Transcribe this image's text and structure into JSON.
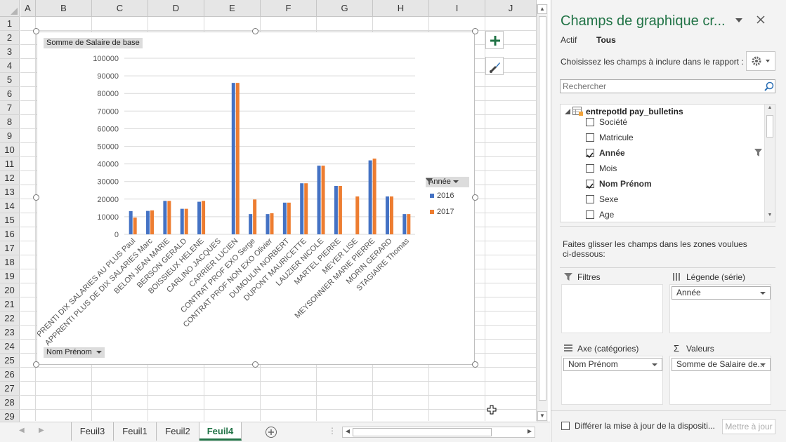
{
  "sheet": {
    "columns": [
      "A",
      "B",
      "C",
      "D",
      "E",
      "F",
      "G",
      "H",
      "I",
      "J"
    ],
    "rows": [
      "1",
      "2",
      "3",
      "4",
      "5",
      "6",
      "7",
      "8",
      "9",
      "10",
      "11",
      "12",
      "13",
      "14",
      "15",
      "16",
      "17",
      "18",
      "19",
      "20",
      "21",
      "22",
      "23",
      "24",
      "25",
      "26",
      "27",
      "28",
      "29"
    ],
    "tabs": [
      "Feuil3",
      "Feuil1",
      "Feuil2",
      "Feuil4"
    ],
    "active_tab": "Feuil4"
  },
  "chart": {
    "values_button": "Somme  de Salaire de base",
    "axis_button": "Nom Prénom",
    "legend_button": "Année",
    "colors": {
      "2016": "#4472c4",
      "2017": "#ed7d31"
    }
  },
  "chart_data": {
    "type": "bar",
    "title": "",
    "xlabel": "",
    "ylabel": "",
    "ylim": [
      0,
      100000
    ],
    "yticks": [
      0,
      10000,
      20000,
      30000,
      40000,
      50000,
      60000,
      70000,
      80000,
      90000,
      100000
    ],
    "grid": true,
    "legend_position": "right",
    "categories": [
      "APPRENTI DIX SALARIES AU PLUS Paul",
      "APPRENTI PLUS DE DIX SALARIES Marc",
      "BELON JEAN MARIE",
      "BERSON GERALD",
      "BOISSIEUX HELENE",
      "CARLINO JACQUES",
      "CARRIER LUCIEN",
      "CONTRAT PROF EXO Serge",
      "CONTRAT PROF NON EXO Olivier",
      "DUMOULIN NORBERT",
      "DUPONT MAURICETTE",
      "LAUZIER NICOLE",
      "MARTEL PIERRE",
      "MEYER LISE",
      "MEYSONNIER MARIE PIERRE",
      "MORIN GERARD",
      "STAGIAIRE Thomas"
    ],
    "series": [
      {
        "name": "2016",
        "values": [
          13200,
          13300,
          19000,
          14500,
          18500,
          0,
          86000,
          11500,
          11500,
          18000,
          29000,
          39000,
          27500,
          0,
          42000,
          21500,
          11500
        ]
      },
      {
        "name": "2017",
        "values": [
          9500,
          13600,
          19000,
          14500,
          19000,
          0,
          86000,
          19800,
          12000,
          18000,
          29000,
          39000,
          27500,
          21500,
          43000,
          21500,
          11500
        ]
      }
    ]
  },
  "pane": {
    "title": "Champs de graphique cr...",
    "tab_active": "Actif",
    "tab_all": "Tous",
    "choose_label": "Choisissez les champs à inclure dans le rapport :",
    "search_placeholder": "Rechercher",
    "table_name": "entrepotId pay_bulletins",
    "fields": [
      {
        "label": "Société",
        "checked": false
      },
      {
        "label": "Matricule",
        "checked": false
      },
      {
        "label": "Année",
        "checked": true
      },
      {
        "label": "Mois",
        "checked": false
      },
      {
        "label": "Nom Prénom",
        "checked": true
      },
      {
        "label": "Sexe",
        "checked": false
      },
      {
        "label": "Age",
        "checked": false
      }
    ],
    "drag_label_1": "Faites glisser les champs dans les zones voulues",
    "drag_label_2": "ci-dessous:",
    "zones": {
      "filters": "Filtres",
      "legend": "Légende (série)",
      "legend_item": "Année",
      "axis": "Axe (catégories)",
      "axis_item": "Nom Prénom",
      "values": "Valeurs",
      "values_item": "Somme de Salaire de..."
    },
    "defer_label": "Différer la mise à jour de la dispositi...",
    "update_button": "Mettre à jour"
  }
}
